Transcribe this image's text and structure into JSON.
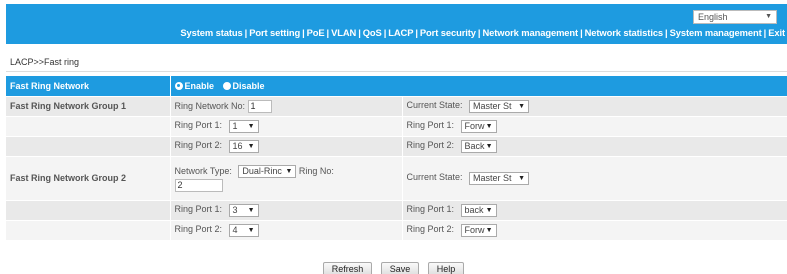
{
  "header": {
    "language": "English",
    "nav": [
      "System status",
      "Port setting",
      "PoE",
      "VLAN",
      "QoS",
      "LACP",
      "Port security",
      "Network management",
      "Network statistics",
      "System management",
      "Exit"
    ],
    "nav_separator": "|"
  },
  "breadcrumb": "LACP>>Fast ring",
  "fast_ring": {
    "title": "Fast Ring Network",
    "enable_label": "Enable",
    "disable_label": "Disable",
    "enabled": true
  },
  "group1": {
    "label": "Fast Ring Network Group 1",
    "ring_network_no_label": "Ring Network No:",
    "ring_network_no": "1",
    "current_state_label": "Current State:",
    "current_state": "Master St",
    "ring_port1_label": "Ring Port 1:",
    "ring_port1": "1",
    "ring_port2_label": "Ring Port 2:",
    "ring_port2": "16",
    "state_port1_label": "Ring Port 1:",
    "state_port1": "Forw",
    "state_port2_label": "Ring Port 2:",
    "state_port2": "Back"
  },
  "group2": {
    "label": "Fast Ring Network Group 2",
    "network_type_label": "Network Type:",
    "network_type": "Dual-Rinc",
    "ring_no_label": "Ring No:",
    "ring_no": "2",
    "current_state_label": "Current State:",
    "current_state": "Master St",
    "ring_port1_label": "Ring Port 1:",
    "ring_port1": "3",
    "ring_port2_label": "Ring Port 2:",
    "ring_port2": "4",
    "state_port1_label": "Ring Port 1:",
    "state_port1": "back",
    "state_port2_label": "Ring Port 2:",
    "state_port2": "Forw"
  },
  "buttons": {
    "refresh": "Refresh",
    "save": "Save",
    "help": "Help"
  },
  "colors": {
    "accent": "#1e9be0"
  }
}
